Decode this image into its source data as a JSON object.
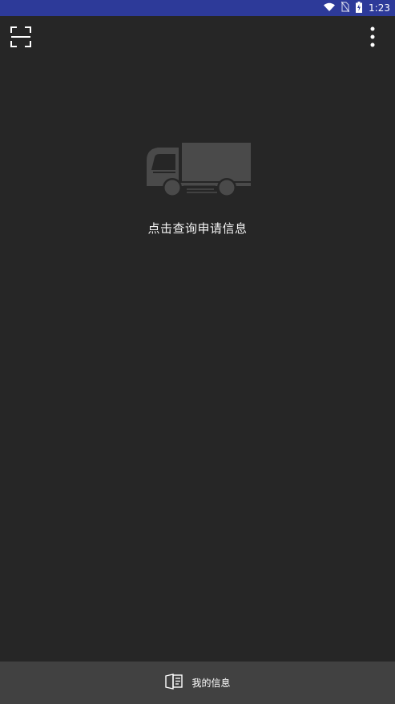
{
  "status_bar": {
    "time": "1:23",
    "icons": [
      "wifi-icon",
      "no-sim-icon",
      "battery-charging-icon"
    ],
    "background": "#2d3a99"
  },
  "app_bar": {
    "left_icon": "scan-icon",
    "right_icon": "more-vert-icon"
  },
  "empty_state": {
    "illustration": "truck-icon",
    "message": "点击查询申请信息"
  },
  "bottom_nav": {
    "items": [
      {
        "icon": "card-info-icon",
        "label": "我的信息"
      }
    ],
    "background": "#414141"
  },
  "colors": {
    "background": "#262626",
    "illustration": "#4a4a4a"
  }
}
